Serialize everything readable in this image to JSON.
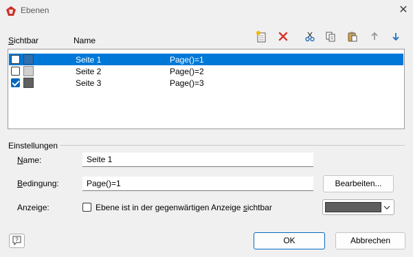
{
  "window": {
    "title": "Ebenen",
    "close_glyph": "✕"
  },
  "columns": {
    "visible": "Sichtbar",
    "visible_mnemonic": "S",
    "visible_rest": "ichtbar",
    "name": "Name"
  },
  "toolbar": {
    "items": [
      {
        "name": "new-layer-icon",
        "tooltip": ""
      },
      {
        "name": "delete-icon",
        "tooltip": ""
      },
      {
        "name": "cut-icon",
        "tooltip": ""
      },
      {
        "name": "copy-icon",
        "tooltip": ""
      },
      {
        "name": "paste-icon",
        "tooltip": ""
      },
      {
        "name": "move-up-icon",
        "tooltip": ""
      },
      {
        "name": "move-down-icon",
        "tooltip": ""
      }
    ]
  },
  "layers": [
    {
      "visible": false,
      "color": "#2e6fae",
      "name": "Seite 1",
      "condition": "Page()=1",
      "selected": true
    },
    {
      "visible": false,
      "color": "#d0d0d0",
      "name": "Seite 2",
      "condition": "Page()=2",
      "selected": false
    },
    {
      "visible": true,
      "color": "#606060",
      "name": "Seite 3",
      "condition": "Page()=3",
      "selected": false
    }
  ],
  "settings": {
    "group_label": "Einstellungen",
    "name_label_mnemonic": "N",
    "name_label_rest": "ame:",
    "name_value": "Seite 1",
    "condition_label_mnemonic": "B",
    "condition_label_rest": "edingung:",
    "condition_value": "Page()=1",
    "edit_button": "Bearbeiten...",
    "display_label": "Anzeige:",
    "visible_checkbox_label_pre": "Ebene ist in der gegenwärtigen Anzeige ",
    "visible_checkbox_label_mnemonic": "s",
    "visible_checkbox_label_post": "ichtbar",
    "visible_checked": false,
    "display_color": "#5e5e5e"
  },
  "footer": {
    "ok": "OK",
    "cancel": "Abbrechen",
    "help_glyph": "?"
  },
  "colors": {
    "selection": "#0078d7",
    "accent": "#0067c0",
    "delete": "#d0342c"
  }
}
